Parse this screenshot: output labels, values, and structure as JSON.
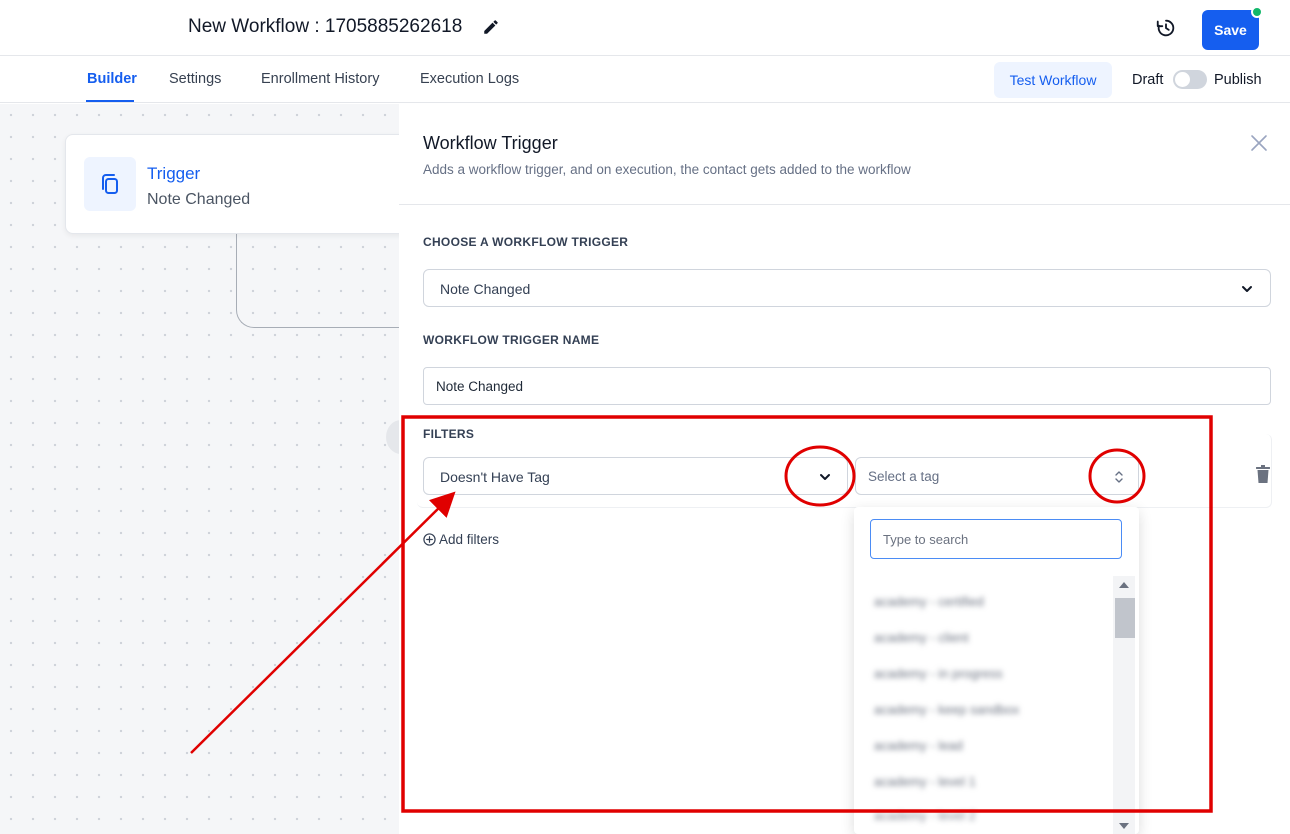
{
  "header": {
    "title": "New Workflow : 1705885262618",
    "save_label": "Save",
    "icons": {
      "edit": "pencil-icon",
      "history": "history-icon"
    },
    "accent_color": "#155eef",
    "status_dot_color": "#12b76a"
  },
  "tabs": [
    {
      "label": "Builder",
      "active": true
    },
    {
      "label": "Settings",
      "active": false
    },
    {
      "label": "Enrollment History",
      "active": false
    },
    {
      "label": "Execution Logs",
      "active": false
    }
  ],
  "toolbar": {
    "test_label": "Test Workflow",
    "draft_label": "Draft",
    "publish_label": "Publish",
    "publish_enabled": false
  },
  "canvas": {
    "trigger_card": {
      "title": "Trigger",
      "subtitle": "Note Changed",
      "icon": "copy-icon"
    }
  },
  "panel": {
    "title": "Workflow Trigger",
    "subtitle": "Adds a workflow trigger, and on execution, the contact gets added to the workflow",
    "trigger_section_label": "CHOOSE A WORKFLOW TRIGGER",
    "trigger_value": "Note Changed",
    "name_section_label": "WORKFLOW TRIGGER NAME",
    "name_value": "Note Changed",
    "filters_label": "FILTERS",
    "filter": {
      "condition": "Doesn't Have Tag",
      "tag_placeholder": "Select a tag"
    },
    "add_filters_label": "Add filters",
    "dropdown": {
      "search_placeholder": "Type to search",
      "options": [
        "academy - certified",
        "academy - client",
        "academy - in progress",
        "academy - keep sandbox",
        "academy - lead",
        "academy - level 1",
        "academy - level 2"
      ]
    }
  },
  "annotations": {
    "color": "#e00000"
  }
}
